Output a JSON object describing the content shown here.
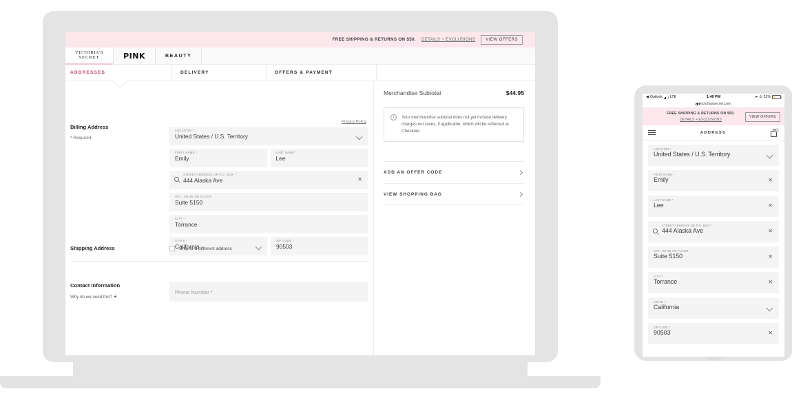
{
  "promo": {
    "text": "FREE SHIPPING & RETURNS ON $50.",
    "link": "DETAILS + EXCLUSIONS",
    "button": "VIEW OFFERS"
  },
  "brand_nav": {
    "vs_line1": "VICTORIA'S",
    "vs_line2": "SECRET",
    "pink": "PINK",
    "beauty": "BEAUTY"
  },
  "steps": {
    "addresses": "ADDRESSES",
    "delivery": "DELIVERY",
    "offers_payment": "OFFERS & PAYMENT"
  },
  "billing": {
    "heading": "Billing Address",
    "required_note": "* Required",
    "privacy_policy": "Privacy Policy",
    "fields": [
      {
        "label": "LOCATION *",
        "value": "United States / U.S. Territory",
        "control": "caret"
      },
      {
        "label": "FIRST NAME *",
        "value": "Emily",
        "control": "none"
      },
      {
        "label": "LAST NAME *",
        "value": "Lee",
        "control": "none"
      },
      {
        "label": "STREET ADDRESS OR P.O. BOX *",
        "value": "444 Alaska Ave",
        "control": "clear"
      },
      {
        "label": "APT., SUITE OR FLOOR",
        "value": "Suite 5150",
        "control": "none"
      },
      {
        "label": "CITY *",
        "value": "Torrance",
        "control": "none"
      },
      {
        "label": "STATE *",
        "value": "California",
        "control": "caret"
      },
      {
        "label": "ZIP CODE *",
        "value": "90503",
        "control": "none"
      }
    ]
  },
  "shipping": {
    "heading": "Shipping Address",
    "checkbox_label": "Ship to a different address",
    "checked": false
  },
  "contact": {
    "heading": "Contact Information",
    "why_link": "Why do we need this?",
    "why_icon": "plus-icon",
    "phone_placeholder": "Phone Number *"
  },
  "summary": {
    "subtotal_label": "Merchandise Subtotal",
    "subtotal_amount": "$44.95",
    "info_icon": "info-icon",
    "note": "Your merchandise subtotal does not yet include delivery charges nor taxes, if applicable, which will be reflected at Checkout.",
    "links": [
      {
        "label": "ADD AN OFFER CODE"
      },
      {
        "label": "VIEW SHOPPING BAG"
      }
    ]
  },
  "phone": {
    "status": {
      "back_app": "Outlook",
      "carrier": "LTE",
      "time": "1:40 PM",
      "battery": "21%",
      "battery_pct": 21
    },
    "url": "victoriassecret.com",
    "promo": {
      "text": "FREE SHIPPING & RETURNS ON $50.",
      "link": "DETAILS + EXCLUSIONS",
      "button": "VIEW OFFERS"
    },
    "nav": {
      "title": "ADDRESS",
      "menu_icon": "hamburger-icon",
      "bag_icon": "shopping-bag-icon",
      "bag_count": "1"
    },
    "fields": [
      {
        "label": "LOCATION *",
        "value": "United States / U.S. Territory",
        "control": "caret"
      },
      {
        "label": "FIRST NAME *",
        "value": "Emily",
        "control": "clear"
      },
      {
        "label": "LAST NAME *",
        "value": "Lee",
        "control": "clear"
      },
      {
        "label": "STREET ADDRESS OR P.O. BOX *",
        "value": "444 Alaska Ave",
        "control": "clear-search"
      },
      {
        "label": "APT., SUITE OR FLOOR",
        "value": "Suite 5150",
        "control": "clear"
      },
      {
        "label": "CITY *",
        "value": "Torrance",
        "control": "clear"
      },
      {
        "label": "STATE *",
        "value": "California",
        "control": "caret"
      },
      {
        "label": "ZIP CODE *",
        "value": "90503",
        "control": "clear"
      }
    ]
  },
  "colors": {
    "promo_bg": "#fbe7ec",
    "accent_pink": "#c4436e",
    "device_gray": "#e4e4e4",
    "field_bg": "#f4f4f4"
  }
}
